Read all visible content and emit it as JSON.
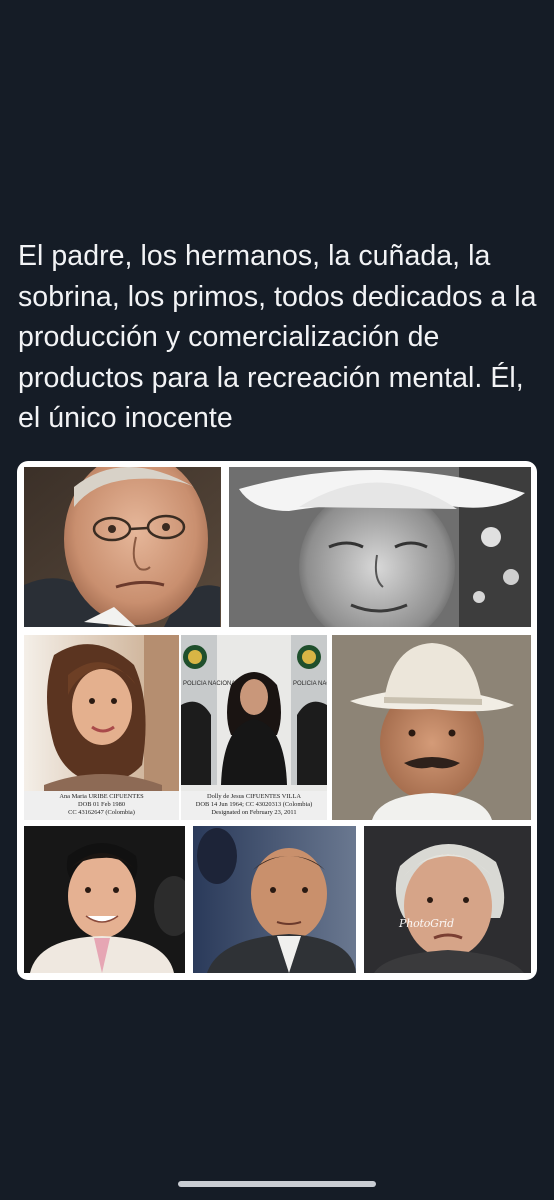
{
  "post": {
    "text": "El padre, los hermanos, la cuñada, la sobrina, los primos, todos dedicados a la producción y comercialización de productos para la recreación mental. Él, el único inocente"
  },
  "media": {
    "photos": [
      {
        "id": "photo-1",
        "caption_lines": []
      },
      {
        "id": "photo-2",
        "caption_lines": []
      },
      {
        "id": "photo-3",
        "caption_lines": [
          "Ana Maria URIBE CIFUENTES",
          "DOB 01 Feb 1980",
          "CC 43162647 (Colombia)"
        ]
      },
      {
        "id": "photo-4",
        "caption_lines": [
          "Dolly de Jesus CIFUENTES VILLA",
          "DOB 14 Jun 1964; CC 43020313 (Colombia)",
          "Designated on February 23, 2011"
        ],
        "sign_left": "POLICIA NACIONAL",
        "sign_right": "POLICIA NACIONAL"
      },
      {
        "id": "photo-5",
        "caption_lines": []
      },
      {
        "id": "photo-6",
        "caption_lines": []
      },
      {
        "id": "photo-7",
        "caption_lines": []
      },
      {
        "id": "photo-8",
        "caption_lines": [],
        "watermark": "PhotoGrid"
      }
    ]
  },
  "colors": {
    "background": "#151c26",
    "text": "#f2f3f5",
    "card": "#ffffff",
    "home_indicator": "#c9cdd3"
  }
}
